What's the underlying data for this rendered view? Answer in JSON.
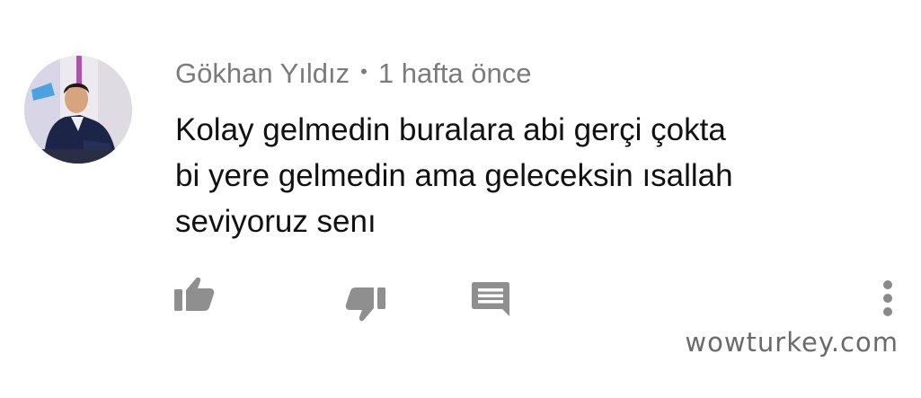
{
  "comment": {
    "author": "Gökhan Yıldız",
    "separator": "•",
    "timestamp": "1 hafta önce",
    "text_lines": [
      "Kolay gelmedin buralara abi gerçi çokta",
      "bi yere gelmedin ama geleceksin ısallah",
      "seviyoruz senı"
    ]
  },
  "actions": {
    "like_icon": "thumbs-up-icon",
    "dislike_icon": "thumbs-down-icon",
    "reply_icon": "comment-icon",
    "more_icon": "vertical-dots-icon"
  },
  "watermark": "wowturkey.com",
  "colors": {
    "meta_text": "#7b7b7b",
    "body_text": "#111111",
    "icon": "#8f8f8f"
  }
}
